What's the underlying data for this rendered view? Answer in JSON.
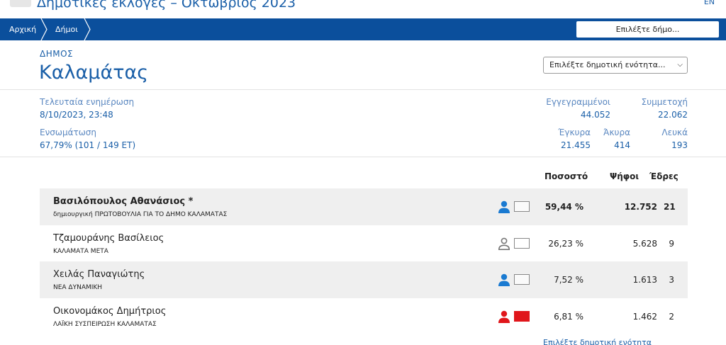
{
  "header": {
    "title": "Δημοτικές εκλογές – Οκτώβριος 2023",
    "lang": "EN"
  },
  "nav": {
    "crumbs": [
      "Αρχική",
      "Δήμοι"
    ],
    "municipality_select": "Επιλέξτε δήμο..."
  },
  "municipality": {
    "label": "ΔΗΜΟΣ",
    "name": "Καλαμάτας",
    "unit_select": "Επιλέξτε δημοτική ενότητα..."
  },
  "stats": {
    "last_update_label": "Τελευταία ενημέρωση",
    "last_update_value": "8/10/2023, 23:48",
    "integration_label": "Ενσωμάτωση",
    "integration_value": "67,79% (101 / 149 ΕΤ)",
    "registered_label": "Εγγεγραμμένοι",
    "registered_value": "44.052",
    "turnout_label": "Συμμετοχή",
    "turnout_value": "22.062",
    "valid_label": "Έγκυρα",
    "valid_value": "21.455",
    "invalid_label": "Άκυρα",
    "invalid_value": "414",
    "blank_label": "Λευκά",
    "blank_value": "193"
  },
  "results": {
    "headers": {
      "percent": "Ποσοστό",
      "votes": "Ψήφοι",
      "seats": "Έδρες"
    },
    "rows": [
      {
        "candidate": "Βασιλόπουλος Αθανάσιος *",
        "party": "δημιουργική ΠΡΩΤΟΒΟΥΛΙΑ ΓΙΑ ΤΟ ΔΗΜΟ ΚΑΛΑΜΑΤΑΣ",
        "percent": "59,44 %",
        "votes": "12.752",
        "seats": "21",
        "icon": "person-icon",
        "icon_color": "#1a7ad1",
        "swatch_color": "#f5f5f5"
      },
      {
        "candidate": "Τζαμουράνης Βασίλειος",
        "party": "ΚΑΛΑΜΑΤΑ ΜΕΤΑ",
        "percent": "26,23 %",
        "votes": "5.628",
        "seats": "9",
        "icon": "person-outline-icon",
        "icon_color": "#777777",
        "swatch_color": "#ffffff"
      },
      {
        "candidate": "Χειλάς Παναγιώτης",
        "party": "ΝΕΑ ΔΥΝΑΜΙΚΗ",
        "percent": "7,52 %",
        "votes": "1.613",
        "seats": "3",
        "icon": "person-icon",
        "icon_color": "#1a7ad1",
        "swatch_color": "#f5f5f5"
      },
      {
        "candidate": "Οικονομάκος Δημήτριος",
        "party": "ΛΑΪΚΗ ΣΥΣΠΕΙΡΩΣΗ ΚΑΛΑΜΑΤΑΣ",
        "percent": "6,81 %",
        "votes": "1.462",
        "seats": "2",
        "icon": "person-icon",
        "icon_color": "#e0161b",
        "swatch_color": "#e0161b"
      }
    ]
  },
  "footer": {
    "link": "Επιλέξτε δημοτική ενότητα"
  }
}
